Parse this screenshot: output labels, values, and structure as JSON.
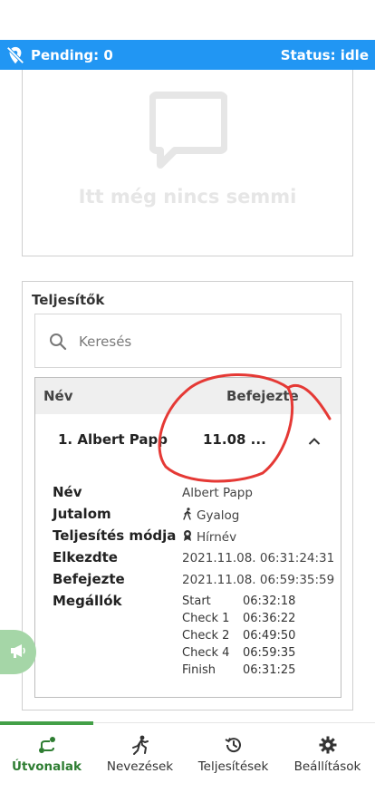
{
  "status": {
    "pending_label": "Pending: 0",
    "status_label": "Status: idle"
  },
  "empty": {
    "text": "Itt még nincs semmi"
  },
  "performers": {
    "title": "Teljesítők",
    "search_placeholder": "Keresés",
    "columns": [
      "Név",
      "Befejezte"
    ],
    "row": {
      "name": "1. Albert Papp",
      "finished": "11.08 ..."
    },
    "details": {
      "name_label": "Név",
      "name_value": "Albert Papp",
      "reward_label": "Jutalom",
      "reward_value": "Gyalog",
      "mode_label": "Teljesítés módja",
      "mode_value": "Hírnév",
      "started_label": "Elkezdte",
      "started_value": "2021.11.08. 06:31:24:31",
      "finished_label": "Befejezte",
      "finished_value": "2021.11.08. 06:59:35:59",
      "stops_label": "Megállók",
      "stops": [
        {
          "name": "Start",
          "time": "06:32:18"
        },
        {
          "name": "Check 1",
          "time": "06:36:22"
        },
        {
          "name": "Check 2",
          "time": "06:49:50"
        },
        {
          "name": "Check 4",
          "time": "06:59:35"
        },
        {
          "name": "Finish",
          "time": "06:31:25"
        }
      ]
    }
  },
  "nav": {
    "items": [
      {
        "label": "Útvonalak",
        "icon": "route-icon"
      },
      {
        "label": "Nevezések",
        "icon": "run-icon"
      },
      {
        "label": "Teljesítések",
        "icon": "history-icon"
      },
      {
        "label": "Beállítások",
        "icon": "gear-icon"
      }
    ]
  },
  "colors": {
    "status_bar": "#2196f3",
    "accent_green": "#2e7d32",
    "fab": "#a5d6a7",
    "annotation": "#e53935"
  }
}
